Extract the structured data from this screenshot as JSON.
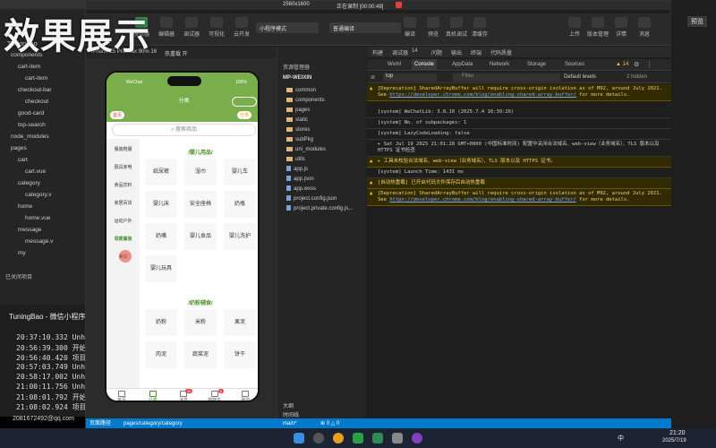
{
  "overlay_title": "效果展示",
  "recording": {
    "resolution": "2560x1600",
    "status": "正在录制 [00:00:49]"
  },
  "left_editor": {
    "project": "TuningBao",
    "tree": [
      {
        "label": "components",
        "indent": 1
      },
      {
        "label": "cart-item",
        "indent": 2
      },
      {
        "label": "cart-item",
        "indent": 3
      },
      {
        "label": "checkout-bar",
        "indent": 2
      },
      {
        "label": "checkout",
        "indent": 3
      },
      {
        "label": "good-card",
        "indent": 2
      },
      {
        "label": "top-search",
        "indent": 2
      },
      {
        "label": "node_modules",
        "indent": 1
      },
      {
        "label": "pages",
        "indent": 1
      },
      {
        "label": "cart",
        "indent": 2
      },
      {
        "label": "cart.vue",
        "indent": 3
      },
      {
        "label": "category",
        "indent": 2
      },
      {
        "label": "category.v",
        "indent": 3
      },
      {
        "label": "home",
        "indent": 2
      },
      {
        "label": "home.vue",
        "indent": 3
      },
      {
        "label": "message",
        "indent": 2
      },
      {
        "label": "message.v",
        "indent": 3
      },
      {
        "label": "my",
        "indent": 2
      }
    ],
    "closed_dir": "已关闭项目",
    "terminal_title": "TuningBao - 微信小程序",
    "terminal_lines": [
      "20:37:10.332 Unha",
      "20:56:39.300 开始",
      "20:56:40.420 项目",
      "20:57:03.749 Unha",
      "20:58:17.002 Unha",
      "21:00:11.756 Unha",
      "21:08:01.792 开始",
      "21:08:02.924 项目"
    ],
    "account": "2081672492@qq.com"
  },
  "toolbar": {
    "left_buttons": [
      "模拟器",
      "编辑器",
      "调试器",
      "可视化",
      "云开发"
    ],
    "mode_select": "小程序模式",
    "compile_select": "普通编译",
    "mid_buttons": [
      "编译",
      "预览",
      "真机调试",
      "清缓存"
    ],
    "right_buttons": [
      "上传",
      "版本管理",
      "详情",
      "消息"
    ]
  },
  "device": {
    "model": "iPhone 15 Pro Max 90% 16",
    "hot_reload": "热重载 开"
  },
  "phone": {
    "status_left": "WeChat",
    "status_right": "100%",
    "nav_title": "分类",
    "left_badge": "首页",
    "right_badge": "分类",
    "search_placeholder": "搜索商品",
    "categories": [
      "服装鞋服",
      "厨具家电",
      "食品饮料",
      "家居百货",
      "运动户外",
      "母婴童装",
      "美妆"
    ],
    "active_category_index": 5,
    "sections": [
      {
        "title": "/婴儿用品/",
        "items": [
          "纸尿裤",
          "湿巾",
          "婴儿车",
          "婴儿床",
          "安全座椅",
          "奶瓶",
          "奶嘴",
          "婴儿食品",
          "婴儿洗护",
          "婴儿玩具"
        ]
      },
      {
        "title": "/奶粉辅食/",
        "items": [
          "奶粉",
          "米粉",
          "果泥",
          "肉泥",
          "蔬菜泥",
          "饼干"
        ]
      }
    ],
    "tabs": [
      {
        "label": "首页",
        "badge": ""
      },
      {
        "label": "分类",
        "badge": ""
      },
      {
        "label": "消息",
        "badge": "40"
      },
      {
        "label": "购物车",
        "badge": "6"
      },
      {
        "label": "我的",
        "badge": ""
      }
    ],
    "active_tab_index": 1
  },
  "explorer": {
    "header": "资源管理器",
    "root": "MP-WEIXIN",
    "items": [
      {
        "label": "common",
        "type": "folder"
      },
      {
        "label": "components",
        "type": "folder"
      },
      {
        "label": "pages",
        "type": "folder"
      },
      {
        "label": "static",
        "type": "folder"
      },
      {
        "label": "stores",
        "type": "folder"
      },
      {
        "label": "subPkg",
        "type": "folder"
      },
      {
        "label": "uni_modules",
        "type": "folder"
      },
      {
        "label": "utils",
        "type": "folder"
      },
      {
        "label": "app.js",
        "type": "file"
      },
      {
        "label": "app.json",
        "type": "file"
      },
      {
        "label": "app.wxss",
        "type": "file"
      },
      {
        "label": "project.config.json",
        "type": "file"
      },
      {
        "label": "project.private.config.js...",
        "type": "file"
      }
    ],
    "outline": "大纲",
    "timeline": "时间线"
  },
  "console": {
    "panel_tabs": [
      "构建",
      "调试器",
      "14",
      "问题",
      "输出",
      "终端",
      "代码质量"
    ],
    "dev_tabs": [
      "Wxml",
      "Console",
      "AppData",
      "Network",
      "Storage",
      "Sources"
    ],
    "active_dev_tab": "Console",
    "warn_count": "14",
    "context": "top",
    "filter_placeholder": "Filter",
    "levels": "Default levels",
    "hidden": "2 hidden",
    "logs": [
      {
        "level": "warn",
        "text": "[Deprecation] SharedArrayBuffer will require cross-origin isolation as of M92, around July 2021. See ",
        "link": "https://developer.chrome.com/blog/enabling-shared-array-buffer/",
        "tail": " for more details."
      },
      {
        "level": "info",
        "text": "[system] WeChatLib: 3.8.10 (2025.7.4 16:39:26)"
      },
      {
        "level": "info",
        "text": "[system] No. of subpackages: 1"
      },
      {
        "level": "info",
        "text": "[system] LazyCodeLoading: false"
      },
      {
        "level": "info",
        "text": "▸ Sat Jul 19 2025 21:01:28 GMT+0800 (中国标准时间) 配置中关闭合法域名、web-view（业务域名）、TLS 版本以及 HTTPS 证书检查"
      },
      {
        "level": "warn",
        "text": "▸ 工具未校验合法域名、web-view（业务域名）、TLS 版本以及 HTTPS 证书。"
      },
      {
        "level": "info",
        "text": "[system] Launch Time: 1431 ms"
      },
      {
        "level": "warn",
        "text": "[自动热重载] 已开启代码文件保存后自动热重载"
      },
      {
        "level": "warn",
        "text": "[Deprecation] SharedArrayBuffer will require cross-origin isolation as of M92, around July 2021. See ",
        "link": "https://developer.chrome.com/blog/enabling-shared-array-buffer/",
        "tail": " for more details."
      }
    ]
  },
  "status_bar": {
    "left": "页面路径",
    "path": "pages/category/category",
    "branch": "main*",
    "problems": "⊗ 0 △ 0"
  },
  "taskbar": {
    "time": "21:20",
    "date": "2025/7/19",
    "lang": "中"
  },
  "side_right": {
    "label": "预览"
  }
}
